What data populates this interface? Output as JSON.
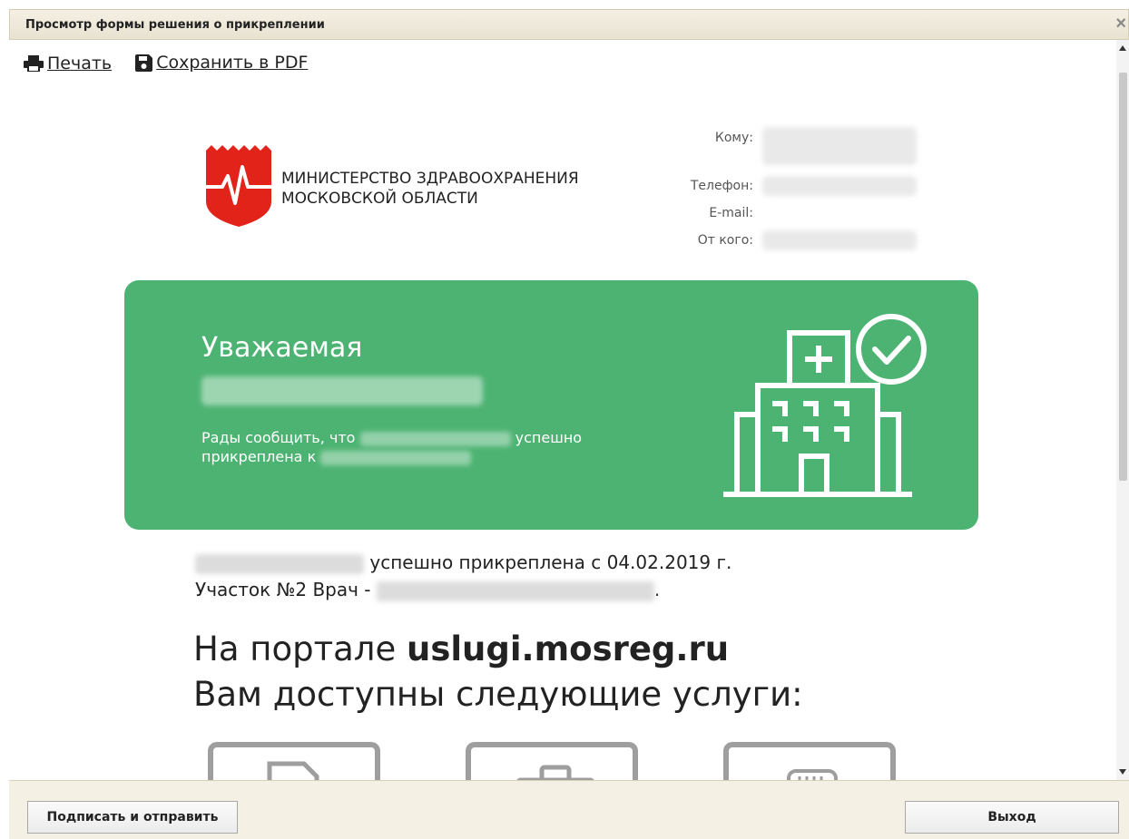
{
  "window": {
    "title": "Просмотр формы решения о прикреплении",
    "close_glyph": "×"
  },
  "toolbar": {
    "print_label": "Печать",
    "pdf_label": "Сохранить в PDF",
    "print_icon": "printer-icon",
    "pdf_icon": "floppy-disk-icon"
  },
  "header": {
    "org_line1": "МИНИСТЕРСТВО ЗДРАВООХРАНЕНИЯ",
    "org_line2": "МОСКОВСКОЙ ОБЛАСТИ",
    "labels": {
      "to": "Кому:",
      "phone": "Телефон:",
      "email": "E-mail:",
      "from": "От кого:"
    }
  },
  "banner": {
    "greeting": "Уважаемая",
    "message_start": "Рады сообщить, что",
    "message_mid": "успешно",
    "message_line2": "прикреплена к",
    "color": "#4db372"
  },
  "body": {
    "attached_text": "успешно прикреплена с 04.02.2019 г.",
    "district_text": "Участок №2 Врач -",
    "district_end": "."
  },
  "portal": {
    "prefix": "На портале ",
    "domain": "uslugi.mosreg.ru",
    "line2": "Вам доступны следующие услуги:"
  },
  "footer": {
    "sign_button": "Подписать и отправить",
    "exit_button": "Выход"
  }
}
